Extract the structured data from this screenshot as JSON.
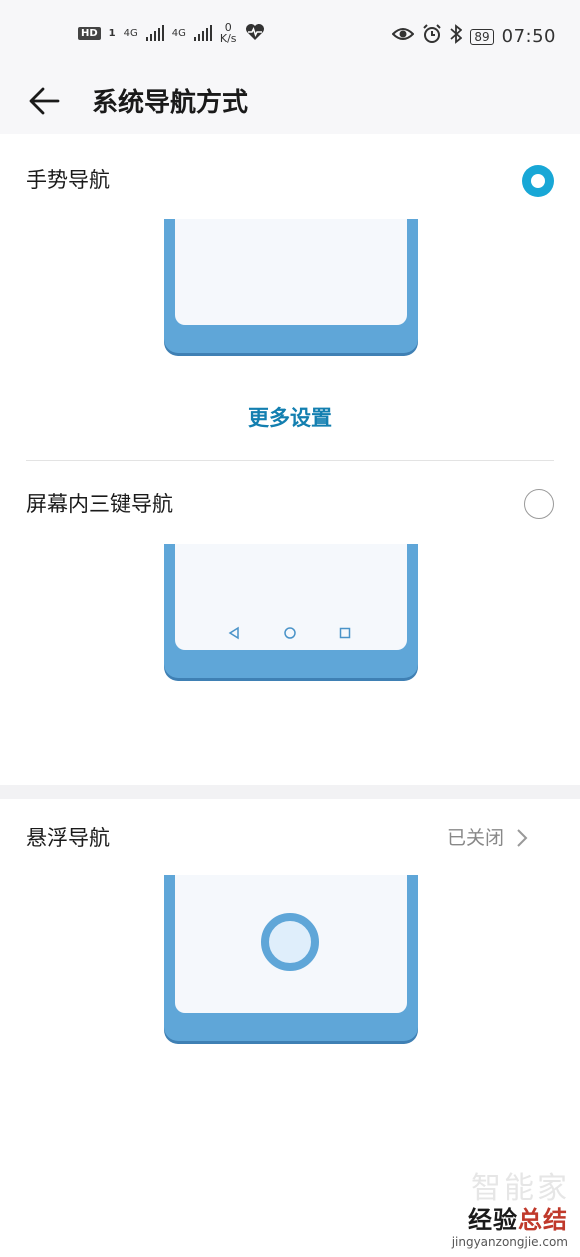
{
  "status_bar": {
    "hd": "HD",
    "sim1": "1",
    "net1": "4G",
    "net2": "4G",
    "speed_value": "0",
    "speed_unit": "K/s",
    "battery": "89",
    "time": "07:50"
  },
  "header": {
    "title": "系统导航方式"
  },
  "options": {
    "gesture": {
      "label": "手势导航",
      "selected": true,
      "more_settings": "更多设置"
    },
    "three_key": {
      "label": "屏幕内三键导航",
      "selected": false
    },
    "floating": {
      "label": "悬浮导航",
      "status": "已关闭"
    }
  },
  "colors": {
    "accent": "#18a7d6",
    "link": "#137fb0",
    "illustration": "#5fa6d8"
  },
  "watermark": {
    "faint": "智能家",
    "main_prefix": "经验",
    "main_accent": "总结",
    "domain": "jingyanzongjie.com"
  }
}
